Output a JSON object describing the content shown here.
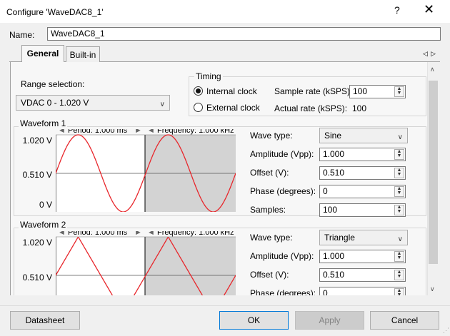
{
  "window": {
    "title": "Configure 'WaveDAC8_1'",
    "help_glyph": "?",
    "close_glyph": "✕"
  },
  "name": {
    "label": "Name:",
    "value": "WaveDAC8_1"
  },
  "tabs": [
    {
      "label": "General"
    },
    {
      "label": "Built-in"
    }
  ],
  "tab_nav": {
    "left": "◁",
    "right": "▷"
  },
  "range": {
    "label": "Range selection:",
    "value": "VDAC 0 - 1.020 V"
  },
  "timing": {
    "title": "Timing",
    "internal_clock": "Internal clock",
    "external_clock": "External clock",
    "selected": "internal",
    "sample_rate_label": "Sample rate (kSPS):",
    "sample_rate_value": "100",
    "actual_rate_label": "Actual rate (kSPS):",
    "actual_rate_value": "100"
  },
  "waveform1": {
    "title": "Waveform 1",
    "period": "Period: 1.000 ms",
    "frequency": "Frequency: 1.000 kHz",
    "y_labels": [
      "1.020 V",
      "0.510 V",
      "0 V"
    ],
    "wave_type_label": "Wave type:",
    "wave_type_value": "Sine",
    "amplitude_label": "Amplitude (Vpp):",
    "amplitude_value": "1.000",
    "offset_label": "Offset (V):",
    "offset_value": "0.510",
    "phase_label": "Phase (degrees):",
    "phase_value": "0",
    "samples_label": "Samples:",
    "samples_value": "100"
  },
  "waveform2": {
    "title": "Waveform 2",
    "period": "Period: 1.000 ms",
    "frequency": "Frequency: 1.000 kHz",
    "y_labels": [
      "1.020 V",
      "0.510 V"
    ],
    "wave_type_label": "Wave type:",
    "wave_type_value": "Triangle",
    "amplitude_label": "Amplitude (Vpp):",
    "amplitude_value": "1.000",
    "offset_label": "Offset (V):",
    "offset_value": "0.510",
    "phase_label": "Phase (degrees):",
    "phase_value": "0"
  },
  "buttons": {
    "datasheet": "Datasheet",
    "ok": "OK",
    "apply": "Apply",
    "cancel": "Cancel"
  },
  "colors": {
    "wave": "#e8262b",
    "shade": "#d3d3d3",
    "accent": "#0078d7"
  }
}
